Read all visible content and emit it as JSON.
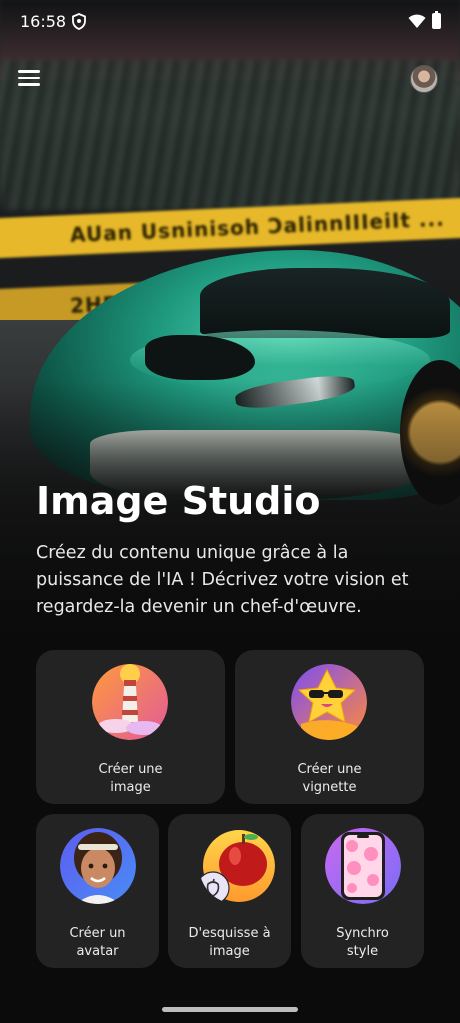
{
  "status_bar": {
    "time": "16:58"
  },
  "hero": {
    "title": "Image Studio",
    "subtitle": "Créez du contenu unique grâce à la puissance de l'IA ! Décrivez votre vision et regardez-la devenir un chef-d'œuvre.",
    "banner_text_1": "AUan Usninisoh  ƆalinnIIIeiIt  ...",
    "banner_text_2": "  2HP  JKJ"
  },
  "cards": [
    {
      "label": "Créer une\nimage",
      "icon": "lighthouse-icon"
    },
    {
      "label": "Créer une\nvignette",
      "icon": "star-sunglasses-icon"
    },
    {
      "label": "Créer un\navatar",
      "icon": "avatar-woman-icon"
    },
    {
      "label": "D'esquisse à\nimage",
      "icon": "apple-sketch-icon"
    },
    {
      "label": "Synchro\nstyle",
      "icon": "phone-pattern-icon"
    }
  ],
  "colors": {
    "background": "#0b0b0b",
    "card": "#232323",
    "accent_teal": "#1f9a7f",
    "banner_yellow": "#e7b82a"
  }
}
